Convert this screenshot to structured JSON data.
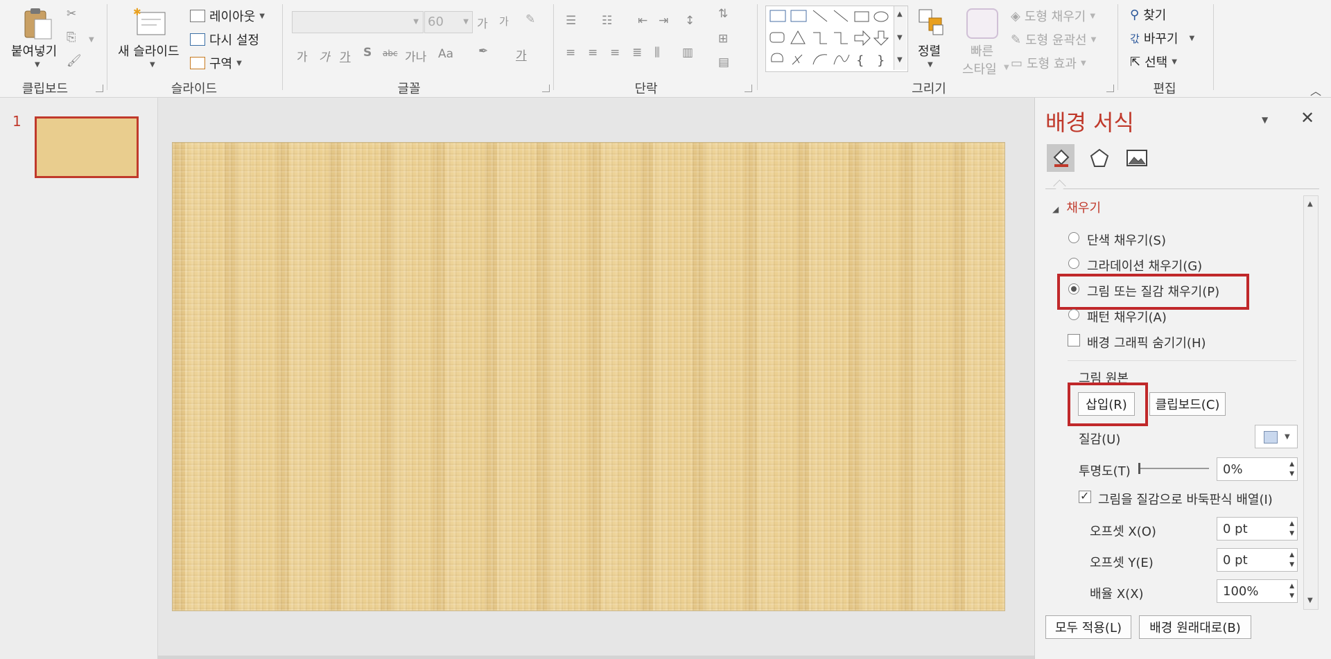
{
  "ribbon": {
    "clipboard": {
      "paste": "붙여넣기",
      "group": "클립보드"
    },
    "slides": {
      "new_slide": "새 슬라이드",
      "layout": "레이아웃",
      "reset": "다시 설정",
      "section": "구역",
      "group": "슬라이드"
    },
    "font": {
      "font_name": "",
      "font_size": "60",
      "grow": "가",
      "shrink": "가",
      "bold": "가",
      "italic": "가",
      "underline": "가",
      "strike": "S",
      "char_spacing": "가나",
      "change_case": "Aa",
      "font_color": "가",
      "group": "글꼴"
    },
    "paragraph": {
      "group": "단락"
    },
    "drawing": {
      "arrange": "정렬",
      "quick_styles_line1": "빠른",
      "quick_styles_line2": "스타일",
      "shape_fill": "도형 채우기",
      "shape_outline": "도형 윤곽선",
      "shape_effects": "도형 효과",
      "group": "그리기"
    },
    "editing": {
      "find": "찾기",
      "replace": "바꾸기",
      "select": "선택",
      "group": "편집"
    }
  },
  "thumbnails": {
    "slide_number": "1"
  },
  "panel": {
    "title": "배경 서식",
    "section_fill": "채우기",
    "options": {
      "solid": "단색 채우기(S)",
      "gradient": "그라데이션 채우기(G)",
      "picture": "그림 또는 질감 채우기(P)",
      "pattern": "패턴 채우기(A)",
      "hide_graphics": "배경 그래픽 숨기기(H)"
    },
    "selected_option": "picture",
    "picture_source_label": "그림 원본",
    "insert_button": "삽입(R)",
    "clipboard_button": "클립보드(C)",
    "texture_label": "질감(U)",
    "transparency_label": "투명도(T)",
    "transparency_value": "0%",
    "tile_checkbox": "그림을 질감으로 바둑판식 배열(I)",
    "tile_checked": true,
    "offset_x_label": "오프셋 X(O)",
    "offset_x_value": "0 pt",
    "offset_y_label": "오프셋 Y(E)",
    "offset_y_value": "0 pt",
    "scale_x_label": "배율 X(X)",
    "scale_x_value": "100%",
    "apply_all_button": "모두 적용(L)",
    "reset_background_button": "배경 원래대로(B)"
  },
  "colors": {
    "accent": "#c0392b",
    "highlight_box": "#c0282a"
  }
}
